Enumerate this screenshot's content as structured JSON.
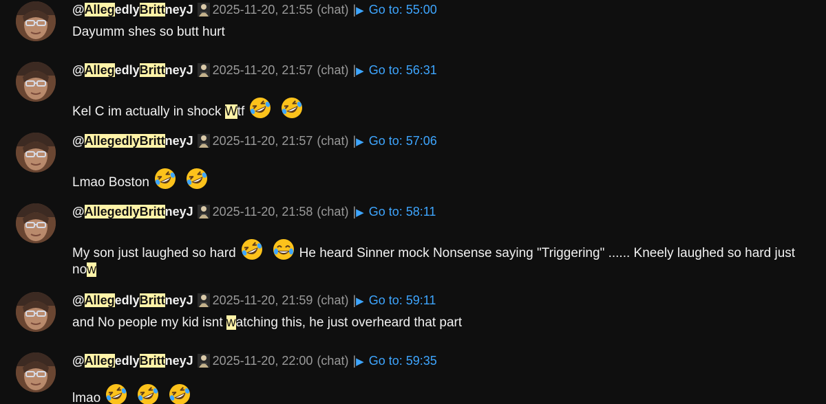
{
  "messages": [
    {
      "handle": {
        "p1": "@",
        "h1": "Alleg",
        "p2": "edly",
        "h2": "Britt",
        "p3": "neyJ"
      },
      "timestamp": "2025-11-20, 21:55",
      "source": "(chat)",
      "sep": "|",
      "goto_label": "Go to: 55:00",
      "text_a": "Dayumm shes so butt hurt"
    },
    {
      "handle": {
        "p1": "@",
        "h1": "Alleg",
        "p2": "edly",
        "h2": "Britt",
        "p3": "neyJ"
      },
      "timestamp": "2025-11-20, 21:57",
      "source": "(chat)",
      "sep": "|",
      "goto_label": "Go to: 56:31",
      "text_a": "Kel C im actually in shock ",
      "text_hl": "W",
      "text_b": "tf",
      "emojis": [
        "rofl-emoji",
        "rofl-emoji"
      ]
    },
    {
      "handle": {
        "p1": "@",
        "h1": "Allegedly",
        "p2": "",
        "h2": "Britt",
        "p3": "neyJ"
      },
      "timestamp": "2025-11-20, 21:57",
      "source": "(chat)",
      "sep": "|",
      "goto_label": "Go to: 57:06",
      "text_a": "Lmao Boston",
      "emojis": [
        "rofl-emoji",
        "rofl-emoji"
      ]
    },
    {
      "handle": {
        "p1": "@",
        "h1": "Allegedly",
        "p2": "",
        "h2": "Britt",
        "p3": "neyJ"
      },
      "timestamp": "2025-11-20, 21:58",
      "source": "(chat)",
      "sep": "|",
      "goto_label": "Go to: 58:11",
      "text_a": "My son just laughed so hard",
      "emojis": [
        "rofl-emoji",
        "joy-emoji"
      ],
      "text_b": "He heard Sinner mock Nonsense saying \"Triggering\" ...... Kneely laughed so hard just no",
      "text_hl": "w"
    },
    {
      "handle": {
        "p1": "@",
        "h1": "Alleg",
        "p2": "edly",
        "h2": "Britt",
        "p3": "neyJ"
      },
      "timestamp": "2025-11-20, 21:59",
      "source": "(chat)",
      "sep": "|",
      "goto_label": "Go to: 59:11",
      "text_a": "and No people my kid isnt ",
      "text_hl": "w",
      "text_b": "atching this, he just overheard that part"
    },
    {
      "handle": {
        "p1": "@",
        "h1": "Alleg",
        "p2": "edly",
        "h2": "Britt",
        "p3": "neyJ"
      },
      "timestamp": "2025-11-20, 22:00",
      "source": "(chat)",
      "sep": "|",
      "goto_label": "Go to: 59:35",
      "text_a": "lmao",
      "emojis": [
        "rofl-emoji",
        "rofl-emoji",
        "rofl-emoji"
      ]
    }
  ]
}
